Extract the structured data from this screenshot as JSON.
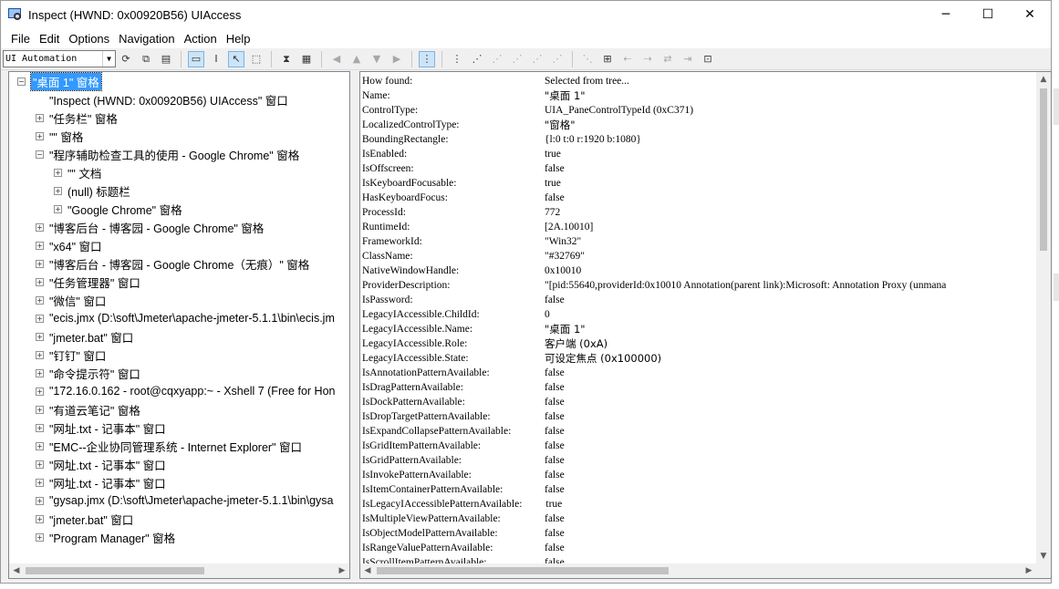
{
  "window": {
    "title": "Inspect  (HWND: 0x00920B56) UIAccess",
    "controls": [
      "─",
      "☐",
      "✕"
    ]
  },
  "menu": [
    "File",
    "Edit",
    "Options",
    "Navigation",
    "Action",
    "Help"
  ],
  "toolbar": {
    "mode": "UI Automation"
  },
  "tree": [
    {
      "label": "\"桌面 1\" 窗格",
      "level": 0,
      "expander": "−",
      "selected": true
    },
    {
      "label": "\"Inspect  (HWND: 0x00920B56) UIAccess\" 窗口",
      "level": 1,
      "expander": ""
    },
    {
      "label": "\"任务栏\" 窗格",
      "level": 1,
      "expander": "+"
    },
    {
      "label": "\"\" 窗格",
      "level": 1,
      "expander": "+"
    },
    {
      "label": "\"程序辅助检查工具的使用 - Google Chrome\" 窗格",
      "level": 1,
      "expander": "−"
    },
    {
      "label": "\"\" 文档",
      "level": 2,
      "expander": "+"
    },
    {
      "label": "(null) 标题栏",
      "level": 2,
      "expander": "+"
    },
    {
      "label": "\"Google Chrome\" 窗格",
      "level": 2,
      "expander": "+"
    },
    {
      "label": "\"博客后台 - 博客园 - Google Chrome\" 窗格",
      "level": 1,
      "expander": "+"
    },
    {
      "label": "\"x64\" 窗口",
      "level": 1,
      "expander": "+"
    },
    {
      "label": "\"博客后台 - 博客园 - Google Chrome（无痕）\" 窗格",
      "level": 1,
      "expander": "+"
    },
    {
      "label": "\"任务管理器\" 窗口",
      "level": 1,
      "expander": "+"
    },
    {
      "label": "\"微信\" 窗口",
      "level": 1,
      "expander": "+"
    },
    {
      "label": "\"ecis.jmx (D:\\soft\\Jmeter\\apache-jmeter-5.1.1\\bin\\ecis.jm",
      "level": 1,
      "expander": "+"
    },
    {
      "label": "\"jmeter.bat\" 窗口",
      "level": 1,
      "expander": "+"
    },
    {
      "label": "\"钉钉\" 窗口",
      "level": 1,
      "expander": "+"
    },
    {
      "label": "\"命令提示符\" 窗口",
      "level": 1,
      "expander": "+"
    },
    {
      "label": "\"172.16.0.162 - root@cqxyapp:~ - Xshell 7 (Free for Hon",
      "level": 1,
      "expander": "+"
    },
    {
      "label": "\"有道云笔记\" 窗格",
      "level": 1,
      "expander": "+"
    },
    {
      "label": "\"网址.txt - 记事本\" 窗口",
      "level": 1,
      "expander": "+"
    },
    {
      "label": "\"EMC--企业协同管理系统 - Internet Explorer\" 窗口",
      "level": 1,
      "expander": "+"
    },
    {
      "label": "\"网址.txt - 记事本\" 窗口",
      "level": 1,
      "expander": "+"
    },
    {
      "label": "\"网址.txt - 记事本\" 窗口",
      "level": 1,
      "expander": "+"
    },
    {
      "label": "\"gysap.jmx (D:\\soft\\Jmeter\\apache-jmeter-5.1.1\\bin\\gysa",
      "level": 1,
      "expander": "+"
    },
    {
      "label": "\"jmeter.bat\" 窗口",
      "level": 1,
      "expander": "+"
    },
    {
      "label": "\"Program Manager\" 窗格",
      "level": 1,
      "expander": "+"
    }
  ],
  "properties": [
    {
      "name": "How found:",
      "value": "Selected from tree..."
    },
    {
      "name": "Name:",
      "value": "\"桌面 1\""
    },
    {
      "name": "ControlType:",
      "value": "UIA_PaneControlTypeId (0xC371)"
    },
    {
      "name": "LocalizedControlType:",
      "value": "\"窗格\""
    },
    {
      "name": "BoundingRectangle:",
      "value": "{l:0 t:0 r:1920 b:1080}"
    },
    {
      "name": "IsEnabled:",
      "value": "true"
    },
    {
      "name": "IsOffscreen:",
      "value": "false"
    },
    {
      "name": "IsKeyboardFocusable:",
      "value": "true"
    },
    {
      "name": "HasKeyboardFocus:",
      "value": "false"
    },
    {
      "name": "ProcessId:",
      "value": "772"
    },
    {
      "name": "RuntimeId:",
      "value": "[2A.10010]"
    },
    {
      "name": "FrameworkId:",
      "value": "\"Win32\""
    },
    {
      "name": "ClassName:",
      "value": "\"#32769\""
    },
    {
      "name": "NativeWindowHandle:",
      "value": "0x10010"
    },
    {
      "name": "ProviderDescription:",
      "value": "\"[pid:55640,providerId:0x10010 Annotation(parent link):Microsoft: Annotation Proxy (unmana"
    },
    {
      "name": "IsPassword:",
      "value": "false"
    },
    {
      "name": "LegacyIAccessible.ChildId:",
      "value": "0"
    },
    {
      "name": "LegacyIAccessible.Name:",
      "value": "\"桌面 1\""
    },
    {
      "name": "LegacyIAccessible.Role:",
      "value": "客户端 (0xA)"
    },
    {
      "name": "LegacyIAccessible.State:",
      "value": "可设定焦点 (0x100000)"
    },
    {
      "name": "IsAnnotationPatternAvailable:",
      "value": "false"
    },
    {
      "name": "IsDragPatternAvailable:",
      "value": "false"
    },
    {
      "name": "IsDockPatternAvailable:",
      "value": "false"
    },
    {
      "name": "IsDropTargetPatternAvailable:",
      "value": "false"
    },
    {
      "name": "IsExpandCollapsePatternAvailable:",
      "value": "false"
    },
    {
      "name": "IsGridItemPatternAvailable:",
      "value": "false"
    },
    {
      "name": "IsGridPatternAvailable:",
      "value": "false"
    },
    {
      "name": "IsInvokePatternAvailable:",
      "value": "false"
    },
    {
      "name": "IsItemContainerPatternAvailable:",
      "value": "false"
    },
    {
      "name": "IsLegacyIAccessiblePatternAvailable:",
      "value": "true"
    },
    {
      "name": "IsMultipleViewPatternAvailable:",
      "value": "false"
    },
    {
      "name": "IsObjectModelPatternAvailable:",
      "value": "false"
    },
    {
      "name": "IsRangeValuePatternAvailable:",
      "value": "false"
    },
    {
      "name": "IsScrollItemPatternAvailable:",
      "value": "false"
    }
  ]
}
